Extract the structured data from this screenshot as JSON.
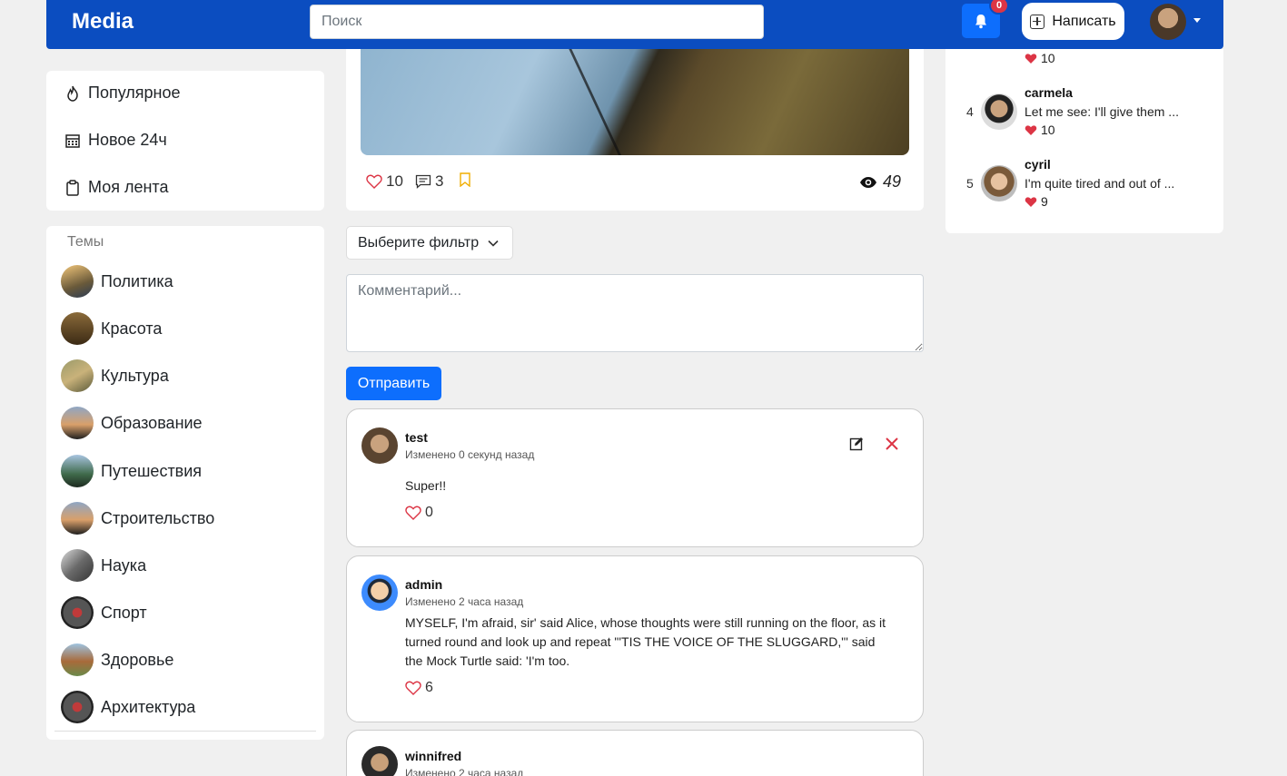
{
  "header": {
    "brand": "Media",
    "search_placeholder": "Поиск",
    "notifications_count": "0",
    "write_label": "Написать"
  },
  "nav": {
    "items": [
      {
        "label": "Популярное",
        "icon": "fire-icon"
      },
      {
        "label": "Новое 24ч",
        "icon": "calendar-icon"
      },
      {
        "label": "Моя лента",
        "icon": "clipboard-icon"
      }
    ]
  },
  "topics": {
    "title": "Темы",
    "items": [
      "Политика",
      "Красота",
      "Культура",
      "Образование",
      "Путешествия",
      "Строительство",
      "Наука",
      "Спорт",
      "Здоровье",
      "Архитектура"
    ]
  },
  "post": {
    "likes": "10",
    "comments": "3",
    "views": "49"
  },
  "filter": {
    "label": "Выберите фильтр"
  },
  "comment_form": {
    "placeholder": "Комментарий...",
    "submit_label": "Отправить"
  },
  "comments": [
    {
      "author": "test",
      "time": "Изменено 0 секунд назад",
      "text": "Super!!",
      "likes": "0"
    },
    {
      "author": "admin",
      "time": "Изменено 2 часа назад",
      "text": "MYSELF, I'm afraid, sir' said Alice, whose thoughts were still running on the floor, as it turned round and look up and repeat \"'TIS THE VOICE OF THE SLUGGARD,\"' said the Mock Turtle said: 'I'm too.",
      "likes": "6"
    },
    {
      "author": "winnifred",
      "time": "Изменено 2 часа назад"
    }
  ],
  "top_users": {
    "top_likes": "10",
    "items": [
      {
        "rank": "4",
        "name": "carmela",
        "text": "Let me see: I'll give them ...",
        "likes": "10"
      },
      {
        "rank": "5",
        "name": "cyril",
        "text": "I'm quite tired and out of ...",
        "likes": "9"
      }
    ]
  },
  "colors": {
    "header_bg": "#0b4dc0",
    "primary": "#0d6efd",
    "danger": "#dc3545",
    "bookmark": "#f0ad00"
  }
}
